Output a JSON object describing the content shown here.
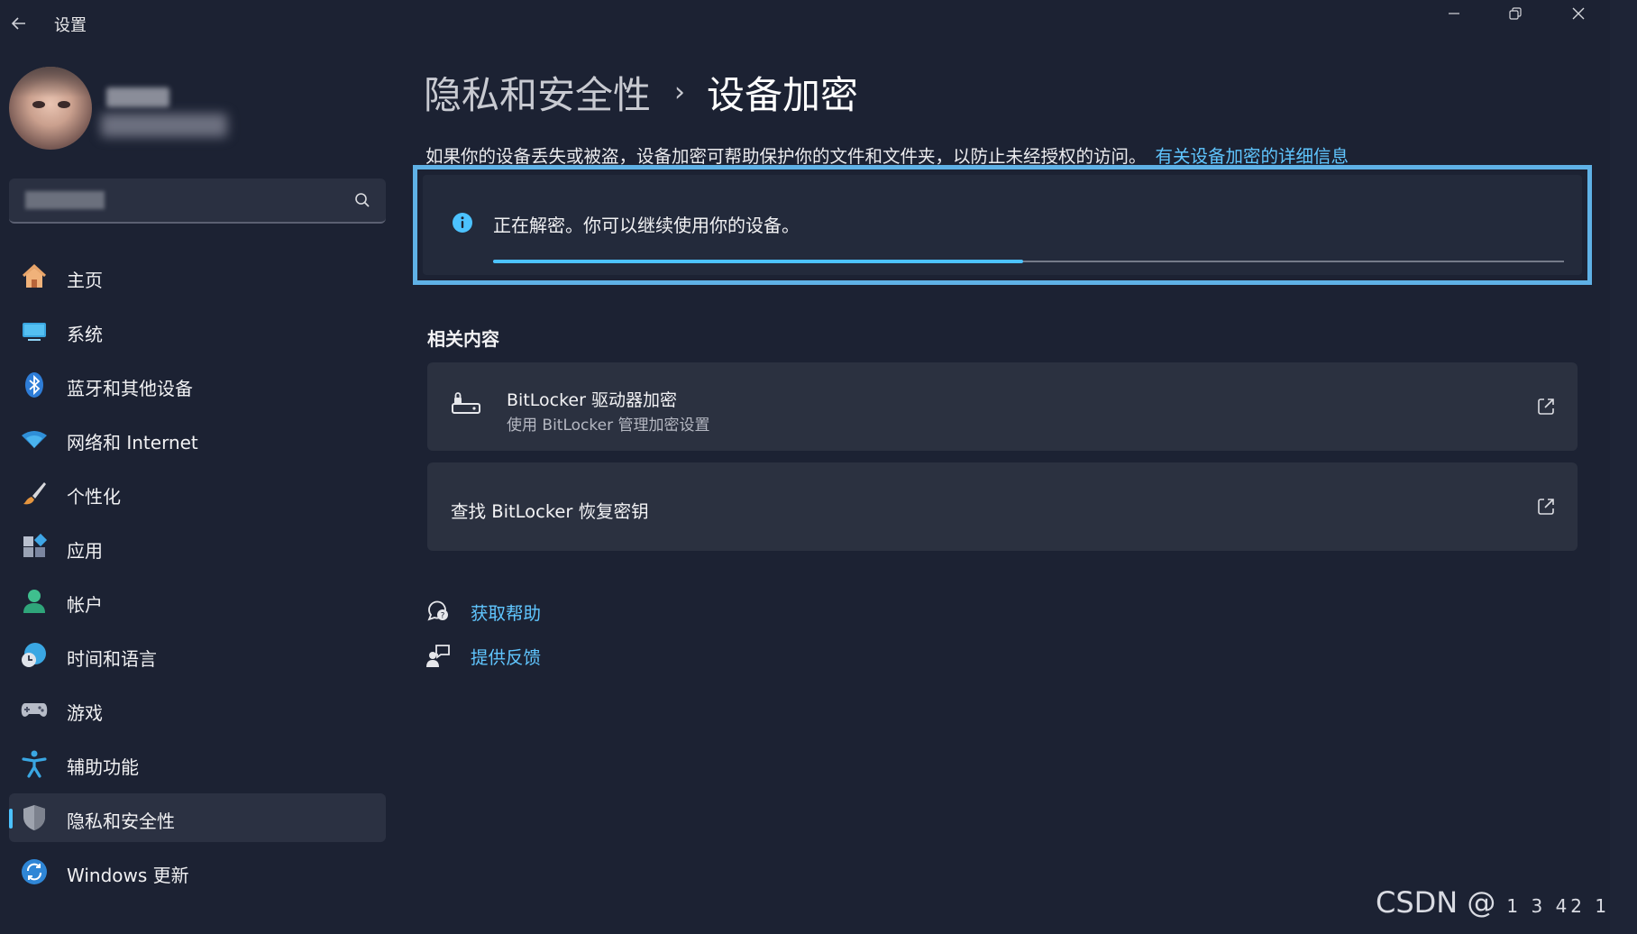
{
  "titlebar": {
    "app_title": "设置",
    "back_icon": "arrow-left-icon",
    "minimize_icon": "minimize-icon",
    "restore_icon": "restore-icon",
    "close_icon": "close-icon"
  },
  "profile": {
    "avatar_icon": "user-avatar"
  },
  "search": {
    "placeholder": "",
    "icon": "search-icon"
  },
  "sidebar": {
    "items": [
      {
        "label": "主页",
        "icon": "home-icon",
        "active": false
      },
      {
        "label": "系统",
        "icon": "system-display-icon",
        "active": false
      },
      {
        "label": "蓝牙和其他设备",
        "icon": "bluetooth-icon",
        "active": false
      },
      {
        "label": "网络和 Internet",
        "icon": "wifi-icon",
        "active": false
      },
      {
        "label": "个性化",
        "icon": "paintbrush-icon",
        "active": false
      },
      {
        "label": "应用",
        "icon": "apps-icon",
        "active": false
      },
      {
        "label": "帐户",
        "icon": "account-icon",
        "active": false
      },
      {
        "label": "时间和语言",
        "icon": "time-language-icon",
        "active": false
      },
      {
        "label": "游戏",
        "icon": "gamepad-icon",
        "active": false
      },
      {
        "label": "辅助功能",
        "icon": "accessibility-icon",
        "active": false
      },
      {
        "label": "隐私和安全性",
        "icon": "shield-icon",
        "active": true
      },
      {
        "label": "Windows 更新",
        "icon": "windows-update-icon",
        "active": false
      }
    ],
    "accent_color": "#4cc2ff"
  },
  "main": {
    "breadcrumb_parent": "隐私和安全性",
    "breadcrumb_separator": "›",
    "breadcrumb_current": "设备加密",
    "description": "如果你的设备丢失或被盗，设备加密可帮助保护你的文件和文件夹，以防止未经授权的访问。",
    "description_link": "有关设备加密的详细信息",
    "status": {
      "icon": "info-icon",
      "text": "正在解密。你可以继续使用你的设备。",
      "progress_fraction": 0.495
    },
    "related_title": "相关内容",
    "related": [
      {
        "title": "BitLocker 驱动器加密",
        "subtitle": "使用 BitLocker 管理加密设置",
        "icon": "bitlocker-drive-icon",
        "action_icon": "open-external-icon"
      },
      {
        "title": "查找 BitLocker 恢复密钥",
        "action_icon": "open-external-icon"
      }
    ],
    "help_links": [
      {
        "label": "获取帮助",
        "icon": "help-chat-icon"
      },
      {
        "label": "提供反馈",
        "icon": "feedback-icon"
      }
    ]
  },
  "watermark": {
    "text": "CSDN @",
    "suffix": "1 3  42 1"
  },
  "colors": {
    "background": "#1c2233",
    "link": "#60c6ff",
    "highlight_border": "#5fb1e6"
  }
}
